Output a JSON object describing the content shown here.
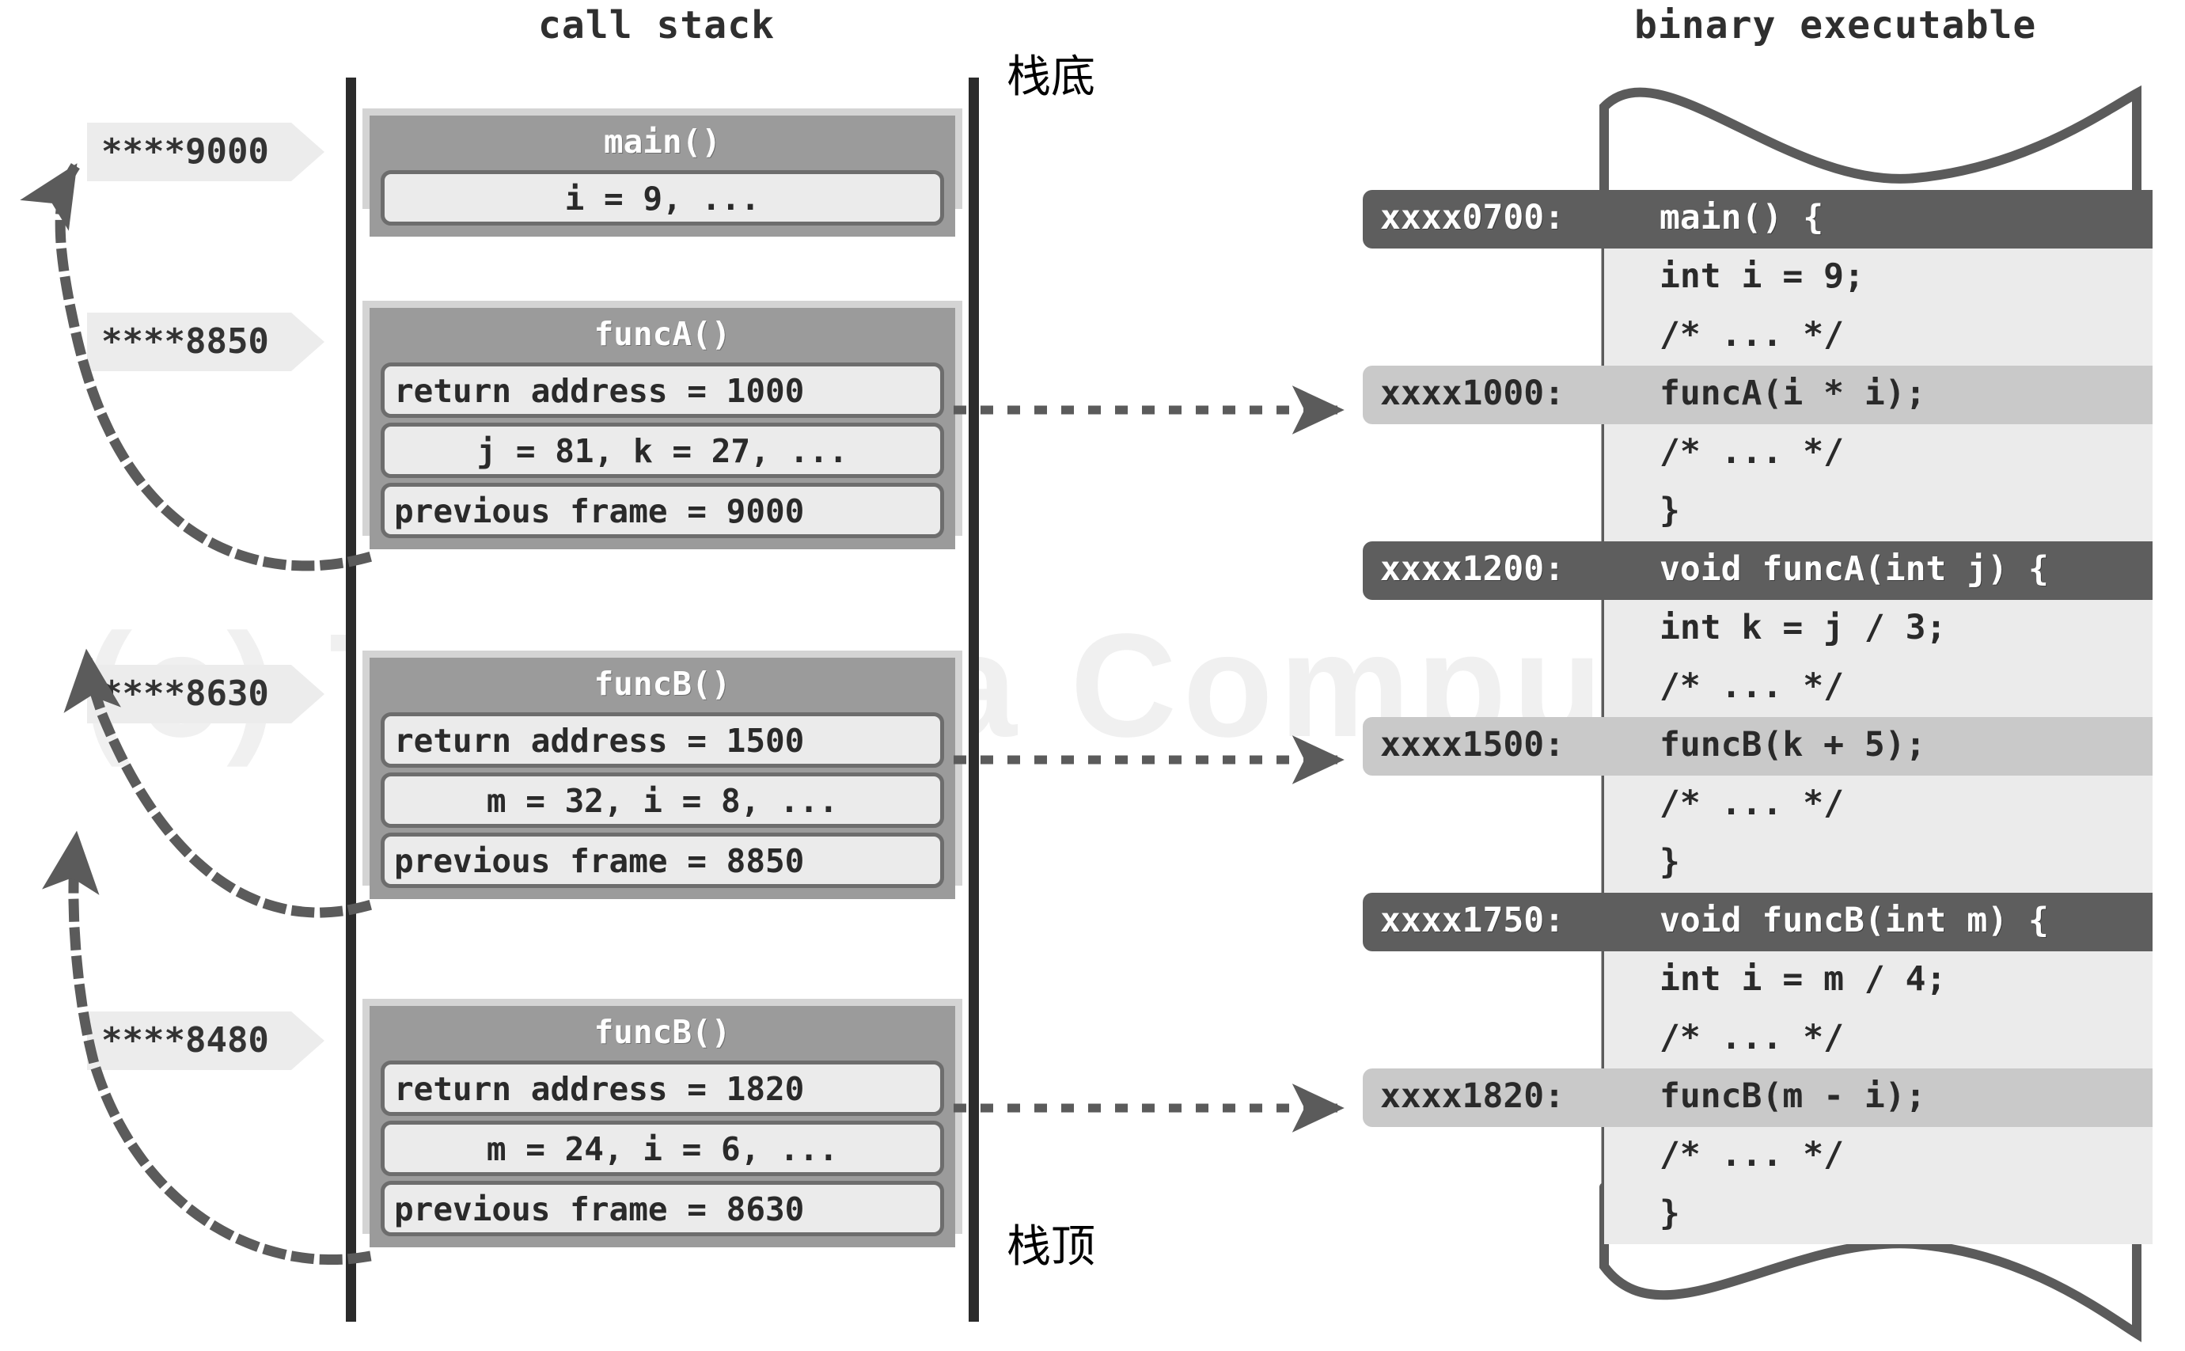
{
  "headings": {
    "call_stack": "call stack",
    "binary_executable": "binary executable"
  },
  "annotations": {
    "stack_bottom": "栈底",
    "stack_top": "栈顶"
  },
  "watermark": "(c) Tsinghua Computer",
  "address_tags": [
    {
      "label": "****9000"
    },
    {
      "label": "****8850"
    },
    {
      "label": "****8630"
    },
    {
      "label": "****8480"
    }
  ],
  "stack_frames": [
    {
      "title": "main()",
      "slots": [
        {
          "text": "i = 9, ...",
          "align": "center"
        }
      ]
    },
    {
      "title": "funcA()",
      "slots": [
        {
          "text": "return address = 1000",
          "align": "left"
        },
        {
          "text": "j = 81, k = 27, ...",
          "align": "center"
        },
        {
          "text": "previous frame = 9000",
          "align": "left"
        }
      ]
    },
    {
      "title": "funcB()",
      "slots": [
        {
          "text": "return address = 1500",
          "align": "left"
        },
        {
          "text": "m = 32, i = 8, ...",
          "align": "center"
        },
        {
          "text": "previous frame = 8850",
          "align": "left"
        }
      ]
    },
    {
      "title": "funcB()",
      "slots": [
        {
          "text": "return address = 1820",
          "align": "left"
        },
        {
          "text": "m = 24, i = 6, ...",
          "align": "center"
        },
        {
          "text": "previous frame = 8630",
          "align": "left"
        }
      ]
    }
  ],
  "code_listing": [
    {
      "address": "xxxx0700:",
      "code": "main() {",
      "style": "hdr"
    },
    {
      "address": "",
      "code": "int i = 9;",
      "style": "body"
    },
    {
      "address": "",
      "code": "/* ... */",
      "style": "body"
    },
    {
      "address": "xxxx1000:",
      "code": "funcA(i * i);",
      "style": "hl"
    },
    {
      "address": "",
      "code": "/* ... */",
      "style": "body"
    },
    {
      "address": "",
      "code": "}",
      "style": "body"
    },
    {
      "address": "xxxx1200:",
      "code": "void funcA(int j) {",
      "style": "hdr"
    },
    {
      "address": "",
      "code": "int k = j / 3;",
      "style": "body"
    },
    {
      "address": "",
      "code": "/* ... */",
      "style": "body"
    },
    {
      "address": "xxxx1500:",
      "code": "funcB(k + 5);",
      "style": "hl"
    },
    {
      "address": "",
      "code": "/* ... */",
      "style": "body"
    },
    {
      "address": "",
      "code": "}",
      "style": "body"
    },
    {
      "address": "xxxx1750:",
      "code": "void funcB(int m) {",
      "style": "hdr"
    },
    {
      "address": "",
      "code": "int i = m / 4;",
      "style": "body"
    },
    {
      "address": "",
      "code": "/* ... */",
      "style": "body"
    },
    {
      "address": "xxxx1820:",
      "code": "funcB(m - i);",
      "style": "hl"
    },
    {
      "address": "",
      "code": "/* ... */",
      "style": "body"
    },
    {
      "address": "",
      "code": "}",
      "style": "body"
    }
  ],
  "colors": {
    "frame_border": "#2b2b2b",
    "frame_body": "#9b9b9b",
    "slot_fill": "#ebebeb",
    "header_dark": "#5e5e5e",
    "highlight": "#c9c9c9",
    "tag_fill": "#ececec",
    "arrow": "#5b5b5b"
  }
}
